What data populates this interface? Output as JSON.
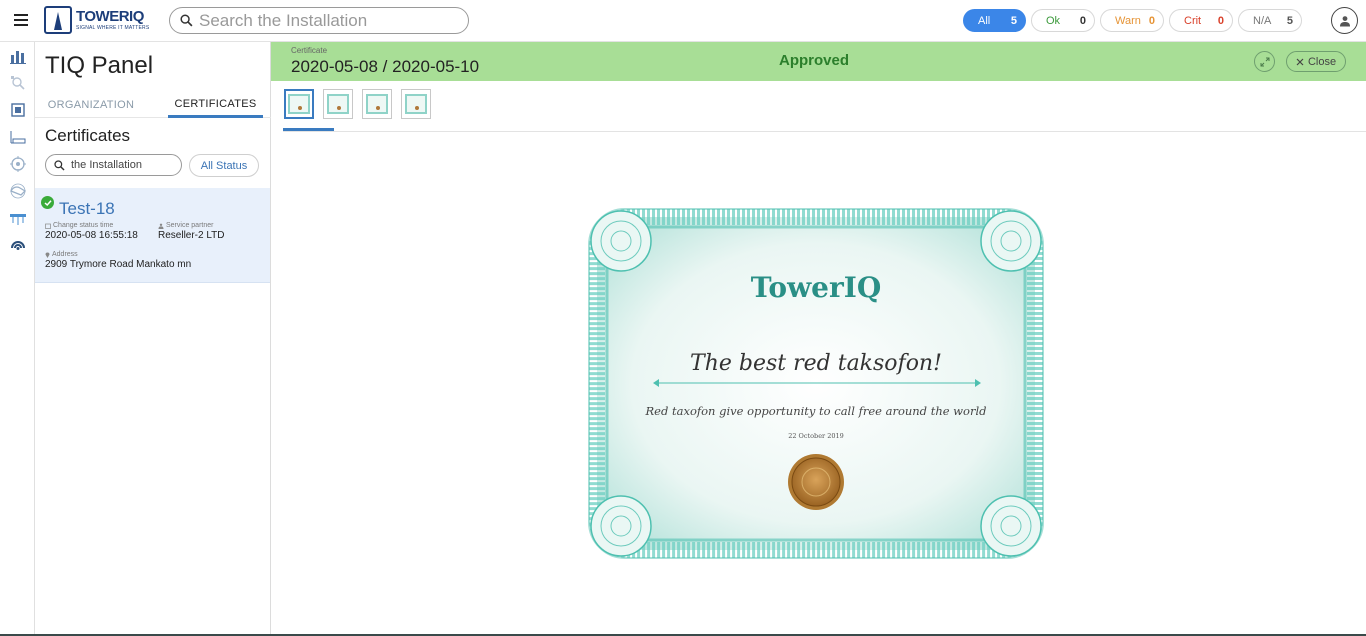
{
  "app": {
    "logo_name": "TOWERIQ",
    "logo_tagline": "SIGNAL WHERE IT MATTERS"
  },
  "search": {
    "placeholder": "Search the Installation"
  },
  "status_filters": [
    {
      "label": "All",
      "count": "5"
    },
    {
      "label": "Ok",
      "count": "0"
    },
    {
      "label": "Warn",
      "count": "0"
    },
    {
      "label": "Crit",
      "count": "0"
    },
    {
      "label": "N/A",
      "count": "5"
    }
  ],
  "rail_icons": [
    "dashboard-icon",
    "search-map-icon",
    "device-icon",
    "network-icon",
    "target-icon",
    "handshake-icon",
    "tower-icon",
    "signal-icon"
  ],
  "panel": {
    "title": "TIQ Panel",
    "tabs": [
      "ORGANIZATION",
      "CERTIFICATES"
    ],
    "section_title": "Certificates",
    "filter_value": "the Installation",
    "all_status_label": "All Status",
    "certificates": [
      {
        "name": "Test-18",
        "change_status_label": "Change status time",
        "change_status_value": "2020-05-08 16:55:18",
        "partner_label": "Service partner",
        "partner_value": "Reseller-2 LTD",
        "address_label": "Address",
        "address_value": "2909 Trymore Road Mankato mn"
      }
    ]
  },
  "banner": {
    "label": "Certificate",
    "dates": "2020-05-08 / 2020-05-10",
    "status": "Approved",
    "close_label": "Close",
    "color": "#a8de96"
  },
  "certificate": {
    "brand": "TowerIQ",
    "headline": "The best red taksofon!",
    "subline": "Red taxofon give opportunity to call free around the world",
    "date": "22 October 2019"
  },
  "colors": {
    "accent": "#3b86e8",
    "ok": "#3c9a3c",
    "warn": "#e69436",
    "crit": "#d9412b",
    "cert_border": "#4ec0b0"
  }
}
